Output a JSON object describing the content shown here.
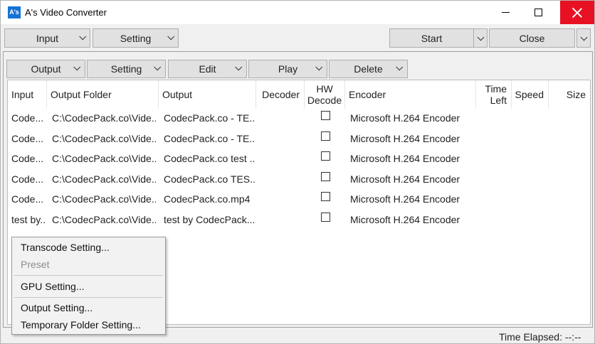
{
  "window": {
    "title": "A's Video Converter",
    "app_icon": "A's",
    "close_color": "#e81123"
  },
  "toolbar": {
    "input_label": "Input",
    "setting_label": "Setting",
    "start_label": "Start",
    "close_label": "Close"
  },
  "subtoolbar": {
    "output_label": "Output",
    "setting_label": "Setting",
    "edit_label": "Edit",
    "play_label": "Play",
    "delete_label": "Delete"
  },
  "table": {
    "headers": {
      "input": "Input",
      "output_folder": "Output Folder",
      "output": "Output",
      "decoder": "Decoder",
      "hw_decode_1": "HW",
      "hw_decode_2": "Decode",
      "encoder": "Encoder",
      "time_left_1": "Time",
      "time_left_2": "Left",
      "speed": "Speed",
      "size": "Size"
    },
    "rows": [
      {
        "input": "Code...",
        "folder": "C:\\CodecPack.co\\Vide...",
        "output": "CodecPack.co - TE...",
        "decoder": "",
        "hw": false,
        "encoder": "Microsoft H.264 Encoder"
      },
      {
        "input": "Code...",
        "folder": "C:\\CodecPack.co\\Vide...",
        "output": "CodecPack.co - TE...",
        "decoder": "",
        "hw": false,
        "encoder": "Microsoft H.264 Encoder"
      },
      {
        "input": "Code...",
        "folder": "C:\\CodecPack.co\\Vide...",
        "output": "CodecPack.co test ...",
        "decoder": "",
        "hw": false,
        "encoder": "Microsoft H.264 Encoder"
      },
      {
        "input": "Code...",
        "folder": "C:\\CodecPack.co\\Vide...",
        "output": "CodecPack.co TES...",
        "decoder": "",
        "hw": false,
        "encoder": "Microsoft H.264 Encoder"
      },
      {
        "input": "Code...",
        "folder": "C:\\CodecPack.co\\Vide...",
        "output": "CodecPack.co.mp4",
        "decoder": "",
        "hw": false,
        "encoder": "Microsoft H.264 Encoder"
      },
      {
        "input": "test by...",
        "folder": "C:\\CodecPack.co\\Vide...",
        "output": "test by CodecPack....",
        "decoder": "",
        "hw": false,
        "encoder": "Microsoft H.264 Encoder"
      }
    ]
  },
  "context_menu": {
    "transcode": "Transcode Setting...",
    "preset": "Preset",
    "gpu": "GPU Setting...",
    "output": "Output Setting...",
    "temp_folder": "Temporary Folder Setting..."
  },
  "status": {
    "time_elapsed": "Time Elapsed: --:--"
  }
}
